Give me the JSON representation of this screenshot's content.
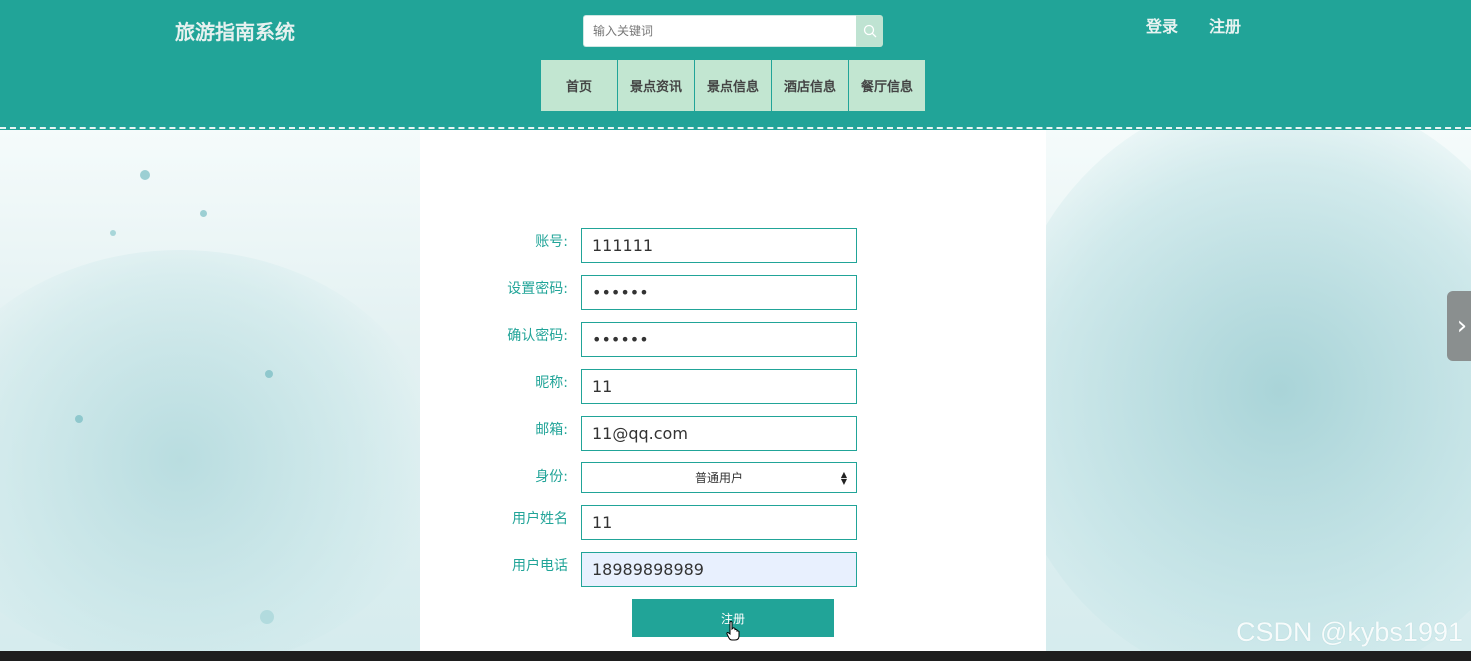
{
  "header": {
    "site_title": "旅游指南系统",
    "search": {
      "placeholder": "输入关键词",
      "value": ""
    },
    "login_label": "登录",
    "register_label": "注册",
    "nav": [
      "首页",
      "景点资讯",
      "景点信息",
      "酒店信息",
      "餐厅信息"
    ]
  },
  "form": {
    "account": {
      "label": "账号:",
      "value": "111111"
    },
    "password": {
      "label": "设置密码:",
      "value": "••••••"
    },
    "confirm_password": {
      "label": "确认密码:",
      "value": "••••••"
    },
    "nickname": {
      "label": "昵称:",
      "value": "11"
    },
    "email": {
      "label": "邮箱:",
      "value": "11@qq.com"
    },
    "role": {
      "label": "身份:",
      "value": "普通用户"
    },
    "real_name": {
      "label": "用户姓名",
      "value": "11"
    },
    "phone": {
      "label": "用户电话",
      "value": "18989898989"
    },
    "submit_label": "注册"
  },
  "watermark": "CSDN @kybs1991",
  "colors": {
    "primary": "#21a498",
    "nav_bg": "#c2e6d1",
    "autofill_bg": "#e8f0fe"
  },
  "icons": {
    "search": "search-icon",
    "side_tab": "chevron-right-icon",
    "cursor": "hand-pointer-icon"
  }
}
